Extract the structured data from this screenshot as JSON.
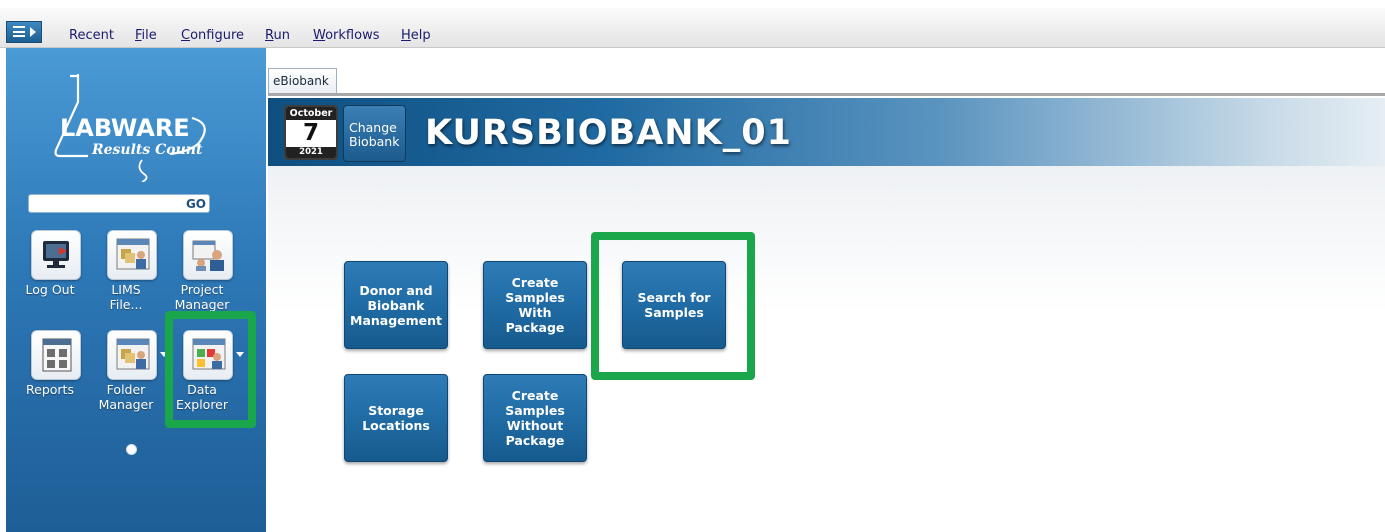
{
  "menubar": {
    "items": [
      {
        "label": "Recent"
      },
      {
        "label": "File",
        "mnemonic": "F",
        "rest": "ile"
      },
      {
        "label": "Configure",
        "mnemonic": "C",
        "rest": "onfigure"
      },
      {
        "label": "Run",
        "mnemonic": "R",
        "rest": "un"
      },
      {
        "label": "Workflows",
        "mnemonic": "W",
        "rest": "orkflows"
      },
      {
        "label": "Help",
        "mnemonic": "H",
        "rest": "elp"
      }
    ],
    "menu_icon": "hamburger-menu-icon"
  },
  "sidebar": {
    "logo": {
      "brand": "LABWARE",
      "subtitle": "Results Count"
    },
    "search": {
      "value": "",
      "go_label": "GO"
    },
    "tiles": [
      {
        "label_line1": "Log Out",
        "label_line2": "",
        "icon": "logout-computer-icon"
      },
      {
        "label_line1": "LIMS",
        "label_line2": "File...",
        "icon": "lims-file-icon"
      },
      {
        "label_line1": "Project",
        "label_line2": "Manager",
        "icon": "project-manager-icon"
      },
      {
        "label_line1": "Reports",
        "label_line2": "",
        "icon": "reports-icon"
      },
      {
        "label_line1": "Folder",
        "label_line2": "Manager",
        "icon": "folder-manager-icon"
      },
      {
        "label_line1": "Data",
        "label_line2": "Explorer",
        "icon": "data-explorer-icon"
      }
    ]
  },
  "main": {
    "tab_label": "eBiobank",
    "calendar": {
      "month": "October",
      "day": "7",
      "year": "2021"
    },
    "change_biobank": {
      "line1": "Change",
      "line2": "Biobank"
    },
    "biobank_name": "KURSBIOBANK_01",
    "actions": [
      {
        "label": "Donor and Biobank Management"
      },
      {
        "label": "Create Samples With Package"
      },
      {
        "label": "Search for Samples"
      },
      {
        "label": "Storage Locations"
      },
      {
        "label": "Create Samples Without Package"
      }
    ]
  },
  "colors": {
    "highlight": "#1aa64b",
    "sidebar_blue": "#2d78b7",
    "button_blue": "#1f6aa3"
  }
}
